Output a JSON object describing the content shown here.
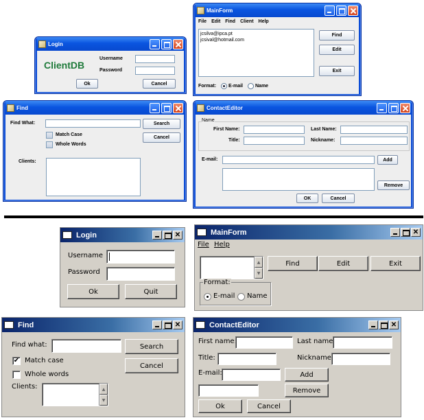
{
  "top": {
    "mainform": {
      "title": "MainForm",
      "menu": [
        "File",
        "Edit",
        "Find",
        "Client",
        "Help"
      ],
      "list_items": [
        "jcsilva@ipca.pt",
        "jcsival@hotmail.com"
      ],
      "buttons": {
        "find": "Find",
        "edit": "Edit",
        "exit": "Exit"
      },
      "format_label": "Format:",
      "radio_email": "E-mail",
      "radio_name": "Name"
    },
    "login": {
      "title": "Login",
      "brand": "ClientDB",
      "username_label": "Username",
      "password_label": "Password",
      "ok": "Ok",
      "cancel": "Cancel"
    },
    "find": {
      "title": "Find",
      "find_what": "Find What:",
      "search": "Search",
      "cancel": "Cancel",
      "match_case": "Match Case",
      "whole_words": "Whole Words",
      "clients": "Clients:"
    },
    "contact": {
      "title": "ContactEditor",
      "group": "Name",
      "first_name": "First Name:",
      "last_name": "Last Name:",
      "title_label": "Title:",
      "nickname": "Nickname:",
      "email": "E-mail:",
      "add": "Add",
      "remove": "Remove",
      "ok": "OK",
      "cancel": "Cancel"
    }
  },
  "bottom": {
    "login": {
      "title": "Login",
      "username_label": "Username",
      "password_label": "Password",
      "ok": "Ok",
      "quit": "Quit"
    },
    "mainform": {
      "title": "MainForm",
      "menu": [
        "File",
        "Help"
      ],
      "buttons": {
        "find": "Find",
        "edit": "Edit",
        "exit": "Exit"
      },
      "format_label": "Format:",
      "radio_email": "E-mail",
      "radio_name": "Name"
    },
    "find": {
      "title": "Find",
      "find_what": "Find what:",
      "search": "Search",
      "cancel": "Cancel",
      "match_case": "Match case",
      "whole_words": "Whole words",
      "clients": "Clients:",
      "match_case_checked": "✔"
    },
    "contact": {
      "title": "ContactEditor",
      "first_name": "First name:",
      "last_name": "Last name:",
      "title_label": "Title:",
      "nickname": "Nickname:",
      "email": "E-mail:",
      "add": "Add",
      "remove": "Remove",
      "ok": "Ok",
      "cancel": "Cancel"
    }
  }
}
